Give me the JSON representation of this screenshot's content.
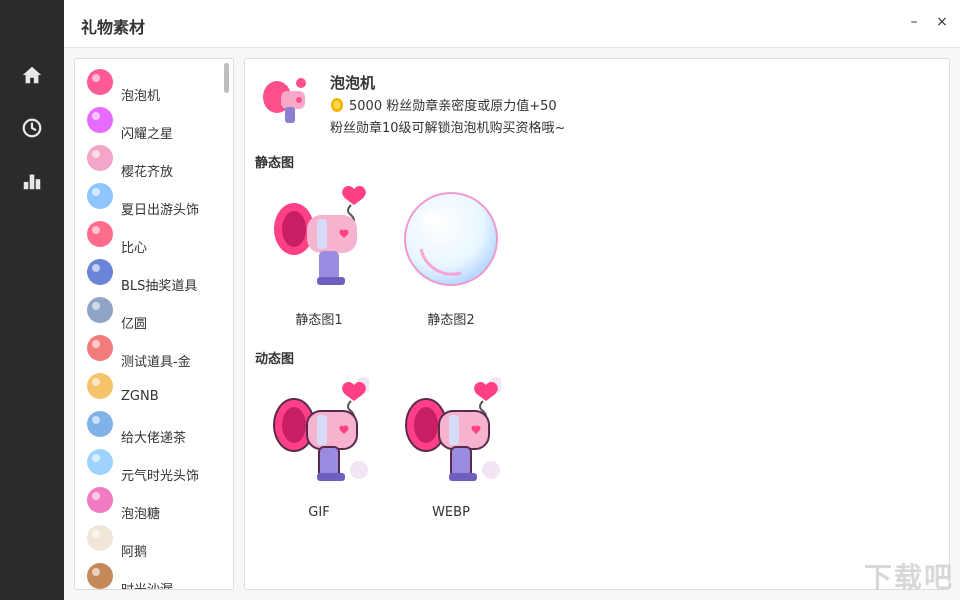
{
  "window": {
    "title": "礼物素材",
    "minimize": "–",
    "close": "×"
  },
  "sidebar": {
    "items": [
      {
        "icon": "home-icon"
      },
      {
        "icon": "history-icon"
      },
      {
        "icon": "chart-icon"
      }
    ]
  },
  "gift_list": {
    "items": [
      {
        "label": "泡泡机",
        "color": "#ff5a96"
      },
      {
        "label": "闪耀之星",
        "color": "#e86bff"
      },
      {
        "label": "樱花齐放",
        "color": "#f3a6c8"
      },
      {
        "label": "夏日出游头饰",
        "color": "#8fc6ff"
      },
      {
        "label": "比心",
        "color": "#ff6b8a"
      },
      {
        "label": "BLS抽奖道具",
        "color": "#6b86d9"
      },
      {
        "label": "亿圆",
        "color": "#8fa4c6"
      },
      {
        "label": "测试道具-金",
        "color": "#f27c7c"
      },
      {
        "label": "ZGNB",
        "color": "#f5c36a"
      },
      {
        "label": "给大佬递茶",
        "color": "#7eb2e8"
      },
      {
        "label": "元气时光头饰",
        "color": "#9ed3ff"
      },
      {
        "label": "泡泡糖",
        "color": "#f27ac0"
      },
      {
        "label": "阿鹅",
        "color": "#f0e7d8"
      },
      {
        "label": "时光沙漏",
        "color": "#c48a5b"
      }
    ]
  },
  "detail": {
    "name": "泡泡机",
    "price": "5000 粉丝勋章亲密度或原力值+50",
    "desc": "粉丝勋章10级可解锁泡泡机购买资格哦~",
    "static_title": "静态图",
    "static_items": [
      {
        "caption": "静态图1"
      },
      {
        "caption": "静态图2"
      }
    ],
    "animated_title": "动态图",
    "animated_items": [
      {
        "caption": "GIF"
      },
      {
        "caption": "WEBP"
      }
    ]
  },
  "watermark": "下载吧",
  "colors": {
    "rail": "#2b2b2b",
    "accent": "#ff4f8b",
    "coin": "#f2b600"
  }
}
